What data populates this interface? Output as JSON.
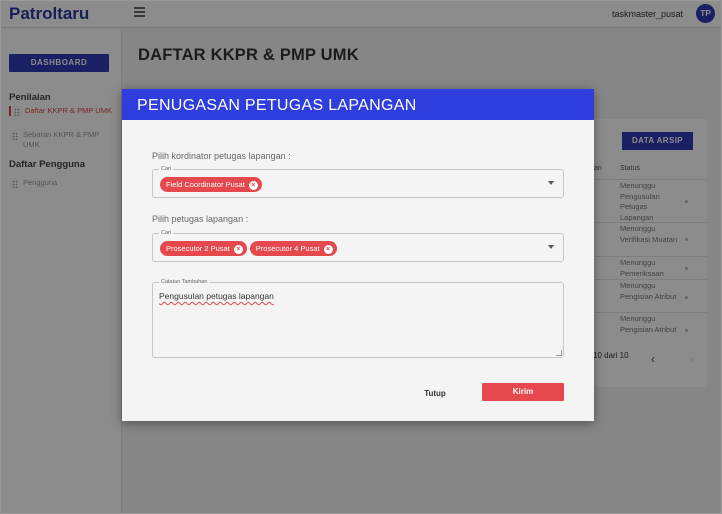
{
  "app": {
    "brand": "Patroltaru",
    "username": "taskmaster_pusat",
    "avatar_initials": "TP"
  },
  "sidebar": {
    "dashboard_label": "DASHBOARD",
    "section_penilaian": "Penilaian",
    "items_penilaian": [
      {
        "label": "Daftar KKPR & PMP UMK",
        "active": true
      },
      {
        "label": "Sebaran KKPR & PMP UMK",
        "active": false
      }
    ],
    "section_pengguna": "Daftar Pengguna",
    "items_pengguna": [
      {
        "label": "Pengguna",
        "active": false
      }
    ]
  },
  "main": {
    "page_title": "DAFTAR KKPR & PMP UMK",
    "archive_button": "DATA ARSIP",
    "columns": [
      "an",
      "Status"
    ],
    "status_rows": [
      "Menunggu Pengusulan Petugas Lapangan",
      "Menunggu Verifikasi Muatan",
      "Menunggu Pemeriksaan",
      "Menunggu Pengisian Atribut",
      "Menunggu Pengisian Atribut"
    ],
    "pagination": "10 dari 10",
    "prev_icon": "‹",
    "next_icon": "›"
  },
  "modal": {
    "title": "PENUGASAN PETUGAS LAPANGAN",
    "coordinator_label": "Pilih kordinator petugas lapangan :",
    "coordinator_legend": "Cari",
    "coordinator_chips": [
      "Field Coordinator Pusat"
    ],
    "officer_label": "Pilih petugas lapangan :",
    "officer_legend": "Cari",
    "officer_chips": [
      "Prosecutor 2 Pusat",
      "Prosecutor 4 Pusat"
    ],
    "notes_legend": "Catatan Tambahan",
    "notes_value": "Pengusulan petugas lapangan",
    "close_label": "Tutup",
    "send_label": "Kirim"
  },
  "colors": {
    "primary": "#2e3bb5",
    "modal_header": "#2e3ddb",
    "accent_red": "#e5484d"
  }
}
